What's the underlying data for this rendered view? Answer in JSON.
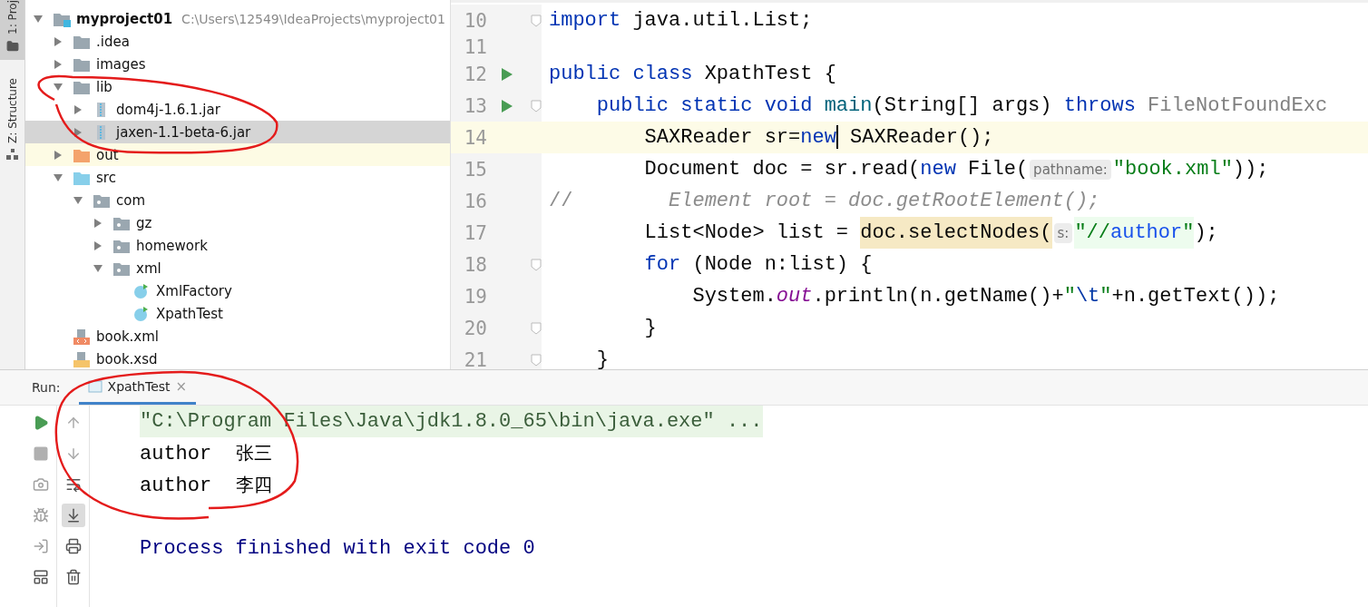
{
  "side_tabs": [
    {
      "label": "1: Proj",
      "selected": true
    },
    {
      "label": "Z: Structure",
      "selected": false
    }
  ],
  "project_tree": [
    {
      "name": "myproject01",
      "path": "C:\\Users\\12549\\IdeaProjects\\myproject01",
      "kind": "project",
      "expanded": true,
      "selected": false,
      "highlighted": false,
      "children": [
        {
          "name": ".idea",
          "kind": "folder",
          "expanded": false,
          "selected": false,
          "highlighted": false
        },
        {
          "name": "images",
          "kind": "folder",
          "expanded": false,
          "selected": false,
          "highlighted": false
        },
        {
          "name": "lib",
          "kind": "folder",
          "expanded": true,
          "selected": false,
          "highlighted": false,
          "children": [
            {
              "name": "dom4j-1.6.1.jar",
              "kind": "jar",
              "expanded": false,
              "selected": false,
              "highlighted": false
            },
            {
              "name": "jaxen-1.1-beta-6.jar",
              "kind": "jar",
              "expanded": false,
              "selected": true,
              "highlighted": false
            }
          ]
        },
        {
          "name": "out",
          "kind": "excluded",
          "expanded": false,
          "selected": false,
          "highlighted": true
        },
        {
          "name": "src",
          "kind": "source",
          "expanded": true,
          "selected": false,
          "highlighted": false,
          "children": [
            {
              "name": "com",
              "kind": "package",
              "expanded": true,
              "selected": false,
              "highlighted": false,
              "children": [
                {
                  "name": "gz",
                  "kind": "package",
                  "expanded": false,
                  "selected": false,
                  "highlighted": false
                },
                {
                  "name": "homework",
                  "kind": "package",
                  "expanded": false,
                  "selected": false,
                  "highlighted": false
                },
                {
                  "name": "xml",
                  "kind": "package",
                  "expanded": true,
                  "selected": false,
                  "highlighted": false,
                  "children": [
                    {
                      "name": "XmlFactory",
                      "kind": "class",
                      "selected": false,
                      "highlighted": false
                    },
                    {
                      "name": "XpathTest",
                      "kind": "class",
                      "selected": false,
                      "highlighted": false
                    }
                  ]
                }
              ]
            }
          ]
        },
        {
          "name": "book.xml",
          "kind": "xml",
          "selected": false,
          "highlighted": false
        },
        {
          "name": "book.xsd",
          "kind": "xsd",
          "selected": false,
          "highlighted": false
        }
      ]
    }
  ],
  "editor": {
    "lines": [
      {
        "number": "10",
        "run": false,
        "fold": true,
        "current": false,
        "tokens": [
          {
            "text": "import",
            "kind": "kw"
          },
          {
            "text": " java.util.List;",
            "kind": "plain"
          }
        ]
      },
      {
        "number": "11",
        "run": false,
        "fold": false,
        "current": false
      },
      {
        "number": "12",
        "run": true,
        "fold": false,
        "current": false,
        "tokens": [
          {
            "text": "public class",
            "kind": "kw"
          },
          {
            "text": " XpathTest {",
            "kind": "plain"
          }
        ]
      },
      {
        "number": "13",
        "run": true,
        "fold": true,
        "current": false,
        "tokens": [
          {
            "text": "    public static void ",
            "kind": "kw"
          },
          {
            "text": "main",
            "kind": "method"
          },
          {
            "text": "(String[] args) ",
            "kind": "plain"
          },
          {
            "text": "throws",
            "kind": "kw"
          },
          {
            "text": " FileNotFoundExc",
            "kind": "muted"
          }
        ]
      },
      {
        "number": "14",
        "run": false,
        "fold": false,
        "current": true,
        "tokens": [
          {
            "text": "        SAXReader sr=",
            "kind": "plain"
          },
          {
            "text": "new",
            "kind": "kw",
            "caret": true
          },
          {
            "text": " SAXReader();",
            "kind": "plain"
          }
        ]
      },
      {
        "number": "15",
        "run": false,
        "fold": false,
        "current": false,
        "tokens": [
          {
            "text": "        Document doc = sr.read(",
            "kind": "plain"
          },
          {
            "text": "new",
            "kind": "kw"
          },
          {
            "text": " File(",
            "kind": "plain"
          },
          {
            "text": "pathname:",
            "kind": "hint"
          },
          {
            "text": "\"book.xml\"",
            "kind": "str"
          },
          {
            "text": "));",
            "kind": "plain"
          }
        ]
      },
      {
        "number": "16",
        "run": false,
        "fold": false,
        "current": false,
        "tokens": [
          {
            "text": "//",
            "kind": "comment"
          },
          {
            "text": "        Element root = doc.getRootElement();",
            "kind": "comment-italic"
          }
        ]
      },
      {
        "number": "17",
        "run": false,
        "fold": false,
        "current": false,
        "tokens": [
          {
            "text": "        List<Node> list = ",
            "kind": "plain"
          },
          {
            "text": "doc.selectNodes(",
            "kind": "usage"
          },
          {
            "text": "s:",
            "kind": "hint"
          },
          {
            "text": "\"//",
            "kind": "str-bg"
          },
          {
            "text": "author",
            "kind": "xpath"
          },
          {
            "text": "\"",
            "kind": "str-bg"
          },
          {
            "text": ");",
            "kind": "plain"
          }
        ]
      },
      {
        "number": "18",
        "run": false,
        "fold": true,
        "current": false,
        "tokens": [
          {
            "text": "        for",
            "kind": "kw"
          },
          {
            "text": " (Node n:list) {",
            "kind": "plain"
          }
        ]
      },
      {
        "number": "19",
        "run": false,
        "fold": false,
        "current": false,
        "tokens": [
          {
            "text": "            System.",
            "kind": "plain"
          },
          {
            "text": "out",
            "kind": "field"
          },
          {
            "text": ".println(n.getName()+",
            "kind": "plain"
          },
          {
            "text": "\"",
            "kind": "str"
          },
          {
            "text": "\\t",
            "kind": "escape"
          },
          {
            "text": "\"",
            "kind": "str"
          },
          {
            "text": "+n.getText());",
            "kind": "plain"
          }
        ]
      },
      {
        "number": "20",
        "run": false,
        "fold": true,
        "current": false,
        "tokens": [
          {
            "text": "        }",
            "kind": "plain"
          }
        ]
      },
      {
        "number": "21",
        "run": false,
        "fold": true,
        "current": false,
        "tokens": [
          {
            "text": "    }",
            "kind": "plain"
          }
        ]
      }
    ]
  },
  "run_panel": {
    "label": "Run:",
    "tabs": [
      {
        "title": "XpathTest",
        "close": "×",
        "selected": true
      }
    ],
    "right_tools": [
      {
        "on": false
      },
      {
        "on": false
      },
      {
        "on": false
      },
      {
        "on": true
      },
      {
        "on": false
      },
      {
        "on": false
      }
    ],
    "console": [
      {
        "kind": "command",
        "text": "\"C:\\Program Files\\Java\\jdk1.8.0_65\\bin\\java.exe\" ..."
      },
      {
        "kind": "output",
        "text": "author\t",
        "cjk": "张三"
      },
      {
        "kind": "output",
        "text": "author\t",
        "cjk": "李四"
      },
      {
        "kind": "blank"
      },
      {
        "kind": "exit",
        "text": "Process finished with exit code 0"
      }
    ]
  }
}
